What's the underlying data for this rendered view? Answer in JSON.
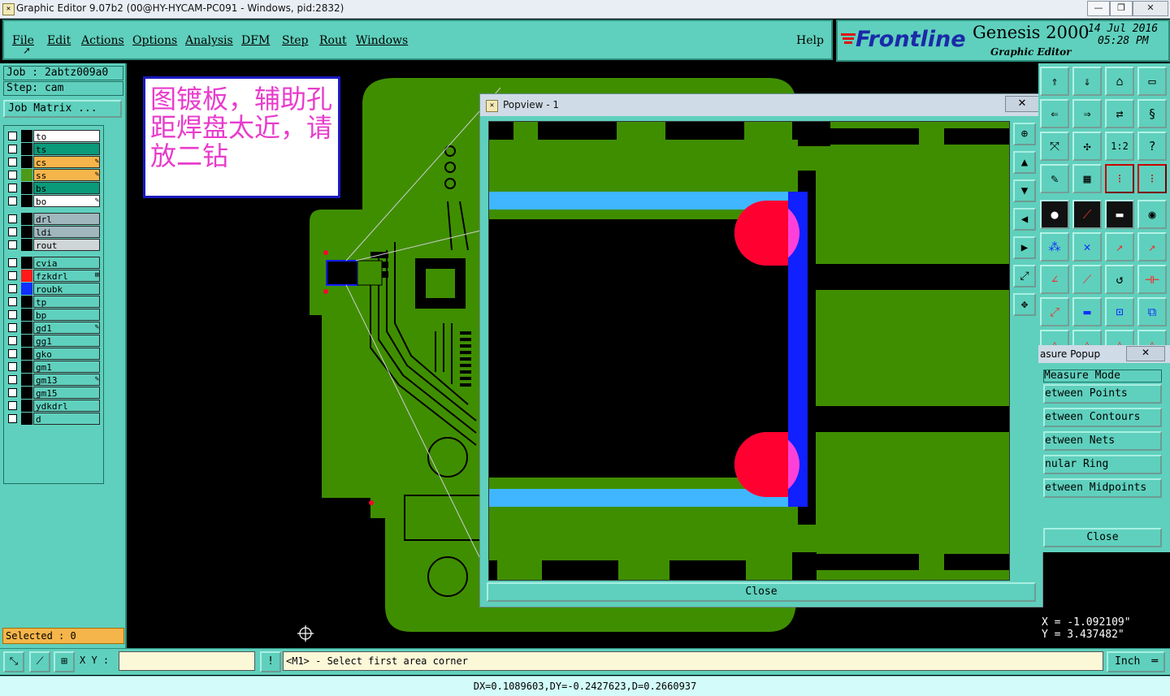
{
  "window": {
    "title": "Graphic Editor 9.07b2 (00@HY-HYCAM-PC091 - Windows, pid:2832)",
    "controls": [
      "—",
      "❐",
      "✕"
    ]
  },
  "menu": {
    "items": [
      "File",
      "Edit",
      "Actions",
      "Options",
      "Analysis",
      "DFM",
      "Step",
      "Rout",
      "Windows"
    ],
    "help": "Help"
  },
  "logo": {
    "brand": "Frontline",
    "product": "Genesis 2000",
    "subtitle": "Graphic Editor",
    "date": "14 Jul 2016",
    "time": "05:28 PM"
  },
  "job": {
    "job_label": "Job : 2abtz009a0",
    "step_label": "Step: cam",
    "matrix_button": "Job Matrix ..."
  },
  "layers": [
    {
      "name": "to",
      "bg": "#ffffff",
      "color": "#000000"
    },
    {
      "name": "ts",
      "bg": "#0a9a7a",
      "color": "#000000"
    },
    {
      "name": "cs",
      "bg": "#f5b54a",
      "color": "#000000",
      "mark": "✎"
    },
    {
      "name": "ss",
      "bg": "#f5b54a",
      "color": "#4c9a18",
      "mark": "✎"
    },
    {
      "name": "bs",
      "bg": "#0a9a7a",
      "color": "#000000"
    },
    {
      "name": "bo",
      "bg": "#ffffff",
      "color": "#000000",
      "mark": "✎"
    },
    {
      "name": "drl",
      "bg": "#9fb7bd",
      "color": "#000000"
    },
    {
      "name": "ldi",
      "bg": "#9fb7bd",
      "color": "#000000"
    },
    {
      "name": "rout",
      "bg": "#cfd6d8",
      "color": "#000000"
    },
    {
      "name": "cvia",
      "bg": "#5fd0bd",
      "color": "#000000"
    },
    {
      "name": "fzkdrl",
      "bg": "#5fd0bd",
      "color": "#ff1a1a",
      "mark": "⊞"
    },
    {
      "name": "roubk",
      "bg": "#5fd0bd",
      "color": "#1030ff"
    },
    {
      "name": "tp",
      "bg": "#5fd0bd",
      "color": "#000000"
    },
    {
      "name": "bp",
      "bg": "#5fd0bd",
      "color": "#000000"
    },
    {
      "name": "gd1",
      "bg": "#5fd0bd",
      "color": "#000000",
      "mark": "✎"
    },
    {
      "name": "gg1",
      "bg": "#5fd0bd",
      "color": "#000000"
    },
    {
      "name": "gko",
      "bg": "#5fd0bd",
      "color": "#000000"
    },
    {
      "name": "gm1",
      "bg": "#5fd0bd",
      "color": "#000000"
    },
    {
      "name": "gm13",
      "bg": "#5fd0bd",
      "color": "#000000",
      "mark": "✎"
    },
    {
      "name": "gm15",
      "bg": "#5fd0bd",
      "color": "#000000"
    },
    {
      "name": "ydkdrl",
      "bg": "#5fd0bd",
      "color": "#000000"
    },
    {
      "name": "d",
      "bg": "#5fd0bd",
      "color": "#000000"
    }
  ],
  "note": {
    "text": "图镀板，辅助孔距焊盘太近，请放二钻"
  },
  "popview": {
    "title": "Popview - 1",
    "close_x": "✕",
    "close_button": "Close"
  },
  "measure": {
    "title": "asure Popup",
    "close_x": "✕",
    "mode_label": "Measure Mode",
    "options": [
      "etween Points",
      "etween Contours",
      "etween Nets",
      "nular Ring",
      "etween Midpoints"
    ],
    "close_button": "Close"
  },
  "coords": {
    "x": "X  =  -1.092109\"",
    "y": "Y  =  3.437482\""
  },
  "selected": "Selected : 0",
  "bottom": {
    "xy_label": "X Y :",
    "prompt": "<M1> - Select first area corner",
    "unit": "Inch",
    "status": "DX=0.1089603,DY=-0.2427623,D=0.2660937"
  },
  "colors": {
    "panel": "#5fd0bd",
    "copper": "#3f8e00",
    "light_blue": "#3fb6ff",
    "rout_blue": "#1020ff",
    "drill_red": "#ff0030",
    "pink": "#ff40d8"
  }
}
